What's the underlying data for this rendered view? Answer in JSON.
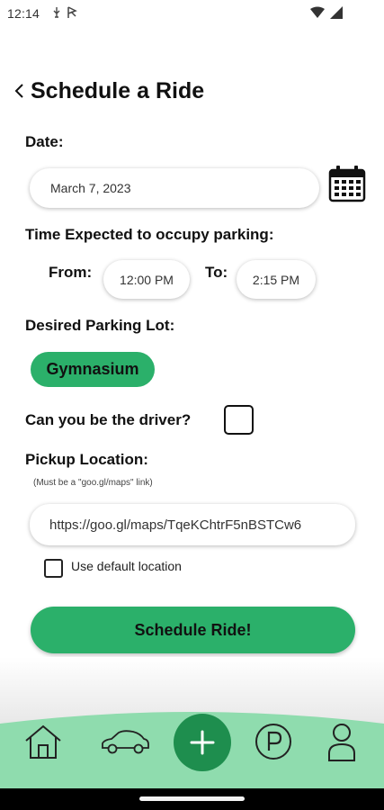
{
  "status_bar": {
    "time": "12:14"
  },
  "header": {
    "title": "Schedule a Ride"
  },
  "form": {
    "date_label": "Date:",
    "date_value": "March 7, 2023",
    "time_label": "Time Expected to occupy parking:",
    "from_label": "From:",
    "from_value": "12:00 PM",
    "to_label": "To:",
    "to_value": "2:15 PM",
    "lot_label": "Desired Parking Lot:",
    "lot_value": "Gymnasium",
    "driver_label": "Can you be the driver?",
    "driver_checked": false,
    "pickup_label": "Pickup Location:",
    "pickup_hint": "(Must be a \"goo.gl/maps\" link)",
    "pickup_value": "https://goo.gl/maps/TqeKChtrF5nBSTCw6",
    "default_location_label": "Use default location",
    "default_location_checked": false,
    "submit_label": "Schedule Ride!"
  },
  "bottom_nav": {
    "items": [
      {
        "icon": "home-icon"
      },
      {
        "icon": "car-icon"
      },
      {
        "icon": "plus-icon"
      },
      {
        "icon": "parking-icon"
      },
      {
        "icon": "profile-icon"
      }
    ]
  },
  "colors": {
    "accent": "#2bb06a",
    "nav_background": "#8fdcae",
    "fab": "#1e8e4e"
  }
}
